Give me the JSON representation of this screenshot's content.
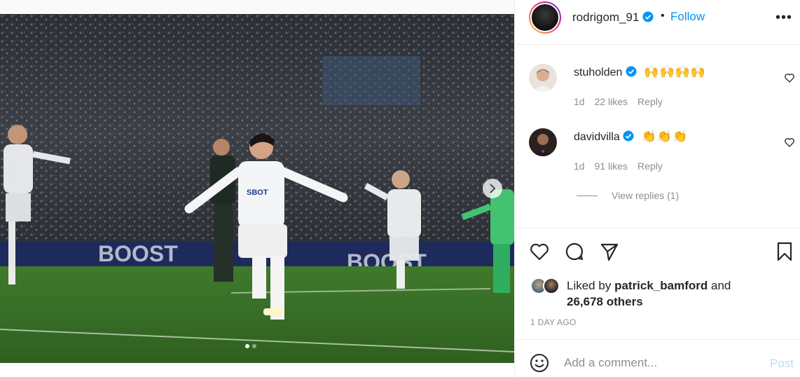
{
  "post": {
    "author": "rodrigom_91",
    "separator": "•",
    "follow_label": "Follow",
    "more_label": "•••",
    "slides_total": 2,
    "slide_active": 1
  },
  "comments": [
    {
      "user": "stuholden",
      "text": "🙌🙌🙌🙌",
      "age": "1d",
      "likes": "22 likes",
      "reply_label": "Reply"
    },
    {
      "user": "davidvilla",
      "text": "👏👏👏",
      "age": "1d",
      "likes": "91 likes",
      "reply_label": "Reply"
    }
  ],
  "view_replies": "View replies (1)",
  "likes": {
    "prefix": "Liked by",
    "user": "patrick_bamford",
    "connector": "and",
    "others": "26,678 others"
  },
  "time_ago": "1 DAY AGO",
  "add_comment": {
    "placeholder": "Add a comment...",
    "post_label": "Post"
  },
  "colors": {
    "accent": "#0095f6",
    "post_disabled": "#b2dffc",
    "muted": "#8e8e8e",
    "text": "#262626"
  }
}
